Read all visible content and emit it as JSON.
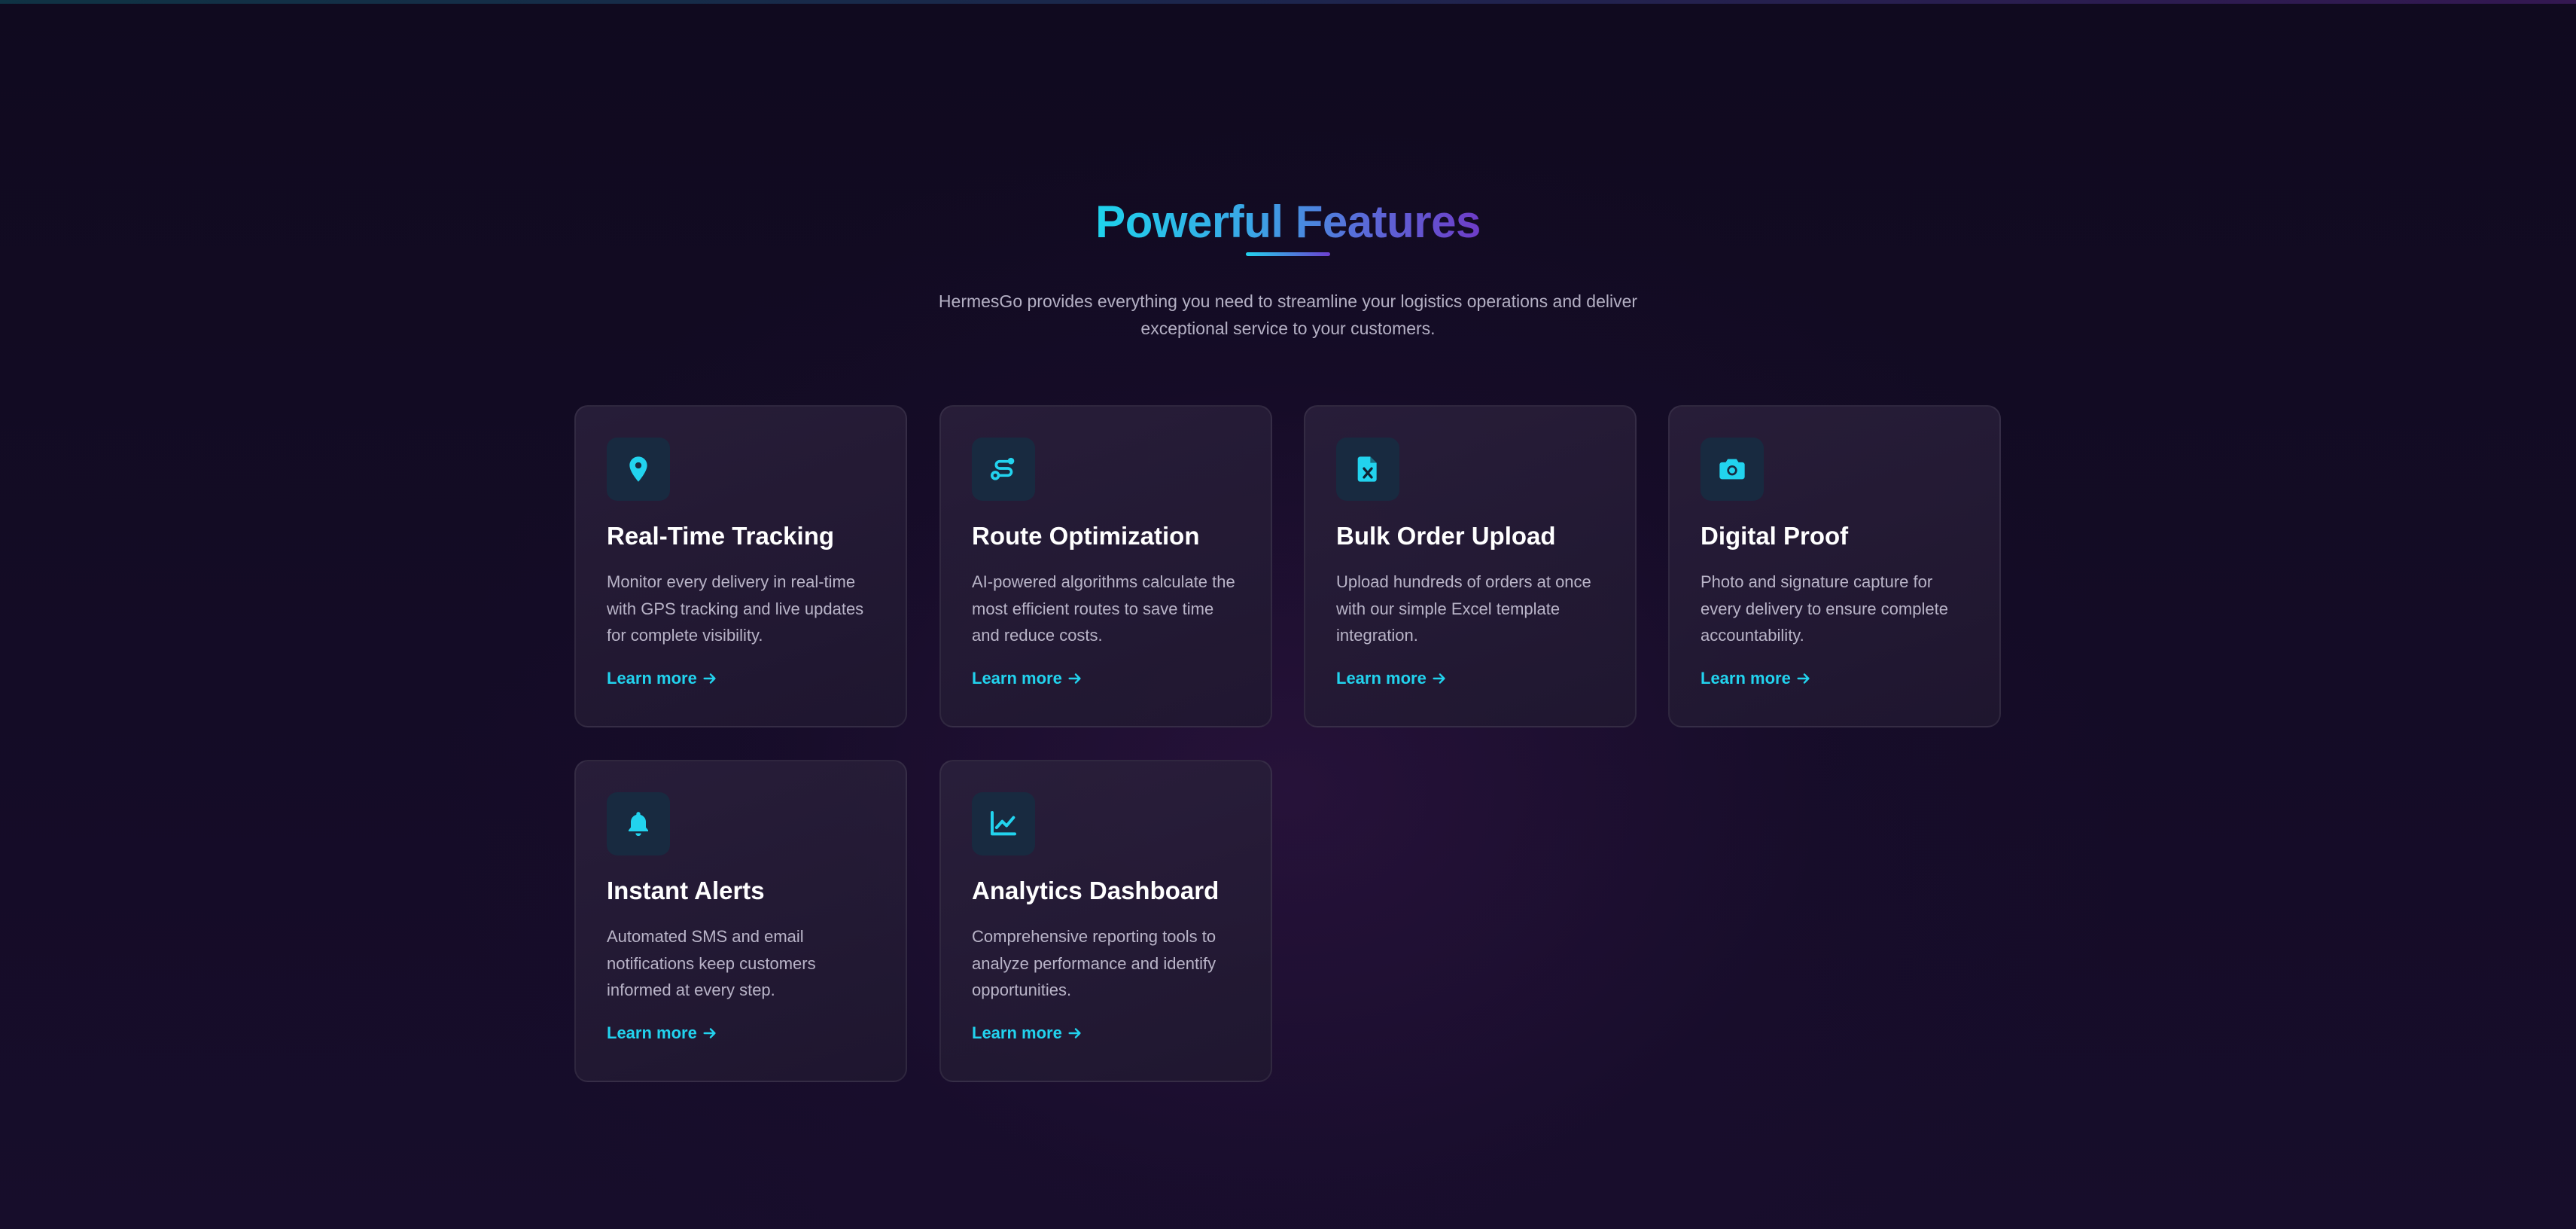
{
  "section": {
    "heading": "Powerful Features",
    "subtitle": "HermesGo provides everything you need to streamline your logistics operations and deliver exceptional service to your customers."
  },
  "colors": {
    "accent": "#22d3ee",
    "accent_purple": "#6d3fd1",
    "background": "#120b23",
    "card_background": "#261d38",
    "icon_background": "#182a40"
  },
  "features": [
    {
      "icon": "map-pin-icon",
      "title": "Real-Time Tracking",
      "description": "Monitor every delivery in real-time with GPS tracking and live updates for complete visibility.",
      "link": "Learn more"
    },
    {
      "icon": "route-icon",
      "title": "Route Optimization",
      "description": "AI-powered algorithms calculate the most efficient routes to save time and reduce costs.",
      "link": "Learn more"
    },
    {
      "icon": "file-excel-icon",
      "title": "Bulk Order Upload",
      "description": "Upload hundreds of orders at once with our simple Excel template integration.",
      "link": "Learn more"
    },
    {
      "icon": "camera-icon",
      "title": "Digital Proof",
      "description": "Photo and signature capture for every delivery to ensure complete accountability.",
      "link": "Learn more"
    },
    {
      "icon": "bell-icon",
      "title": "Instant Alerts",
      "description": "Automated SMS and email notifications keep customers informed at every step.",
      "link": "Learn more"
    },
    {
      "icon": "chart-line-icon",
      "title": "Analytics Dashboard",
      "description": "Comprehensive reporting tools to analyze performance and identify opportunities.",
      "link": "Learn more"
    }
  ]
}
